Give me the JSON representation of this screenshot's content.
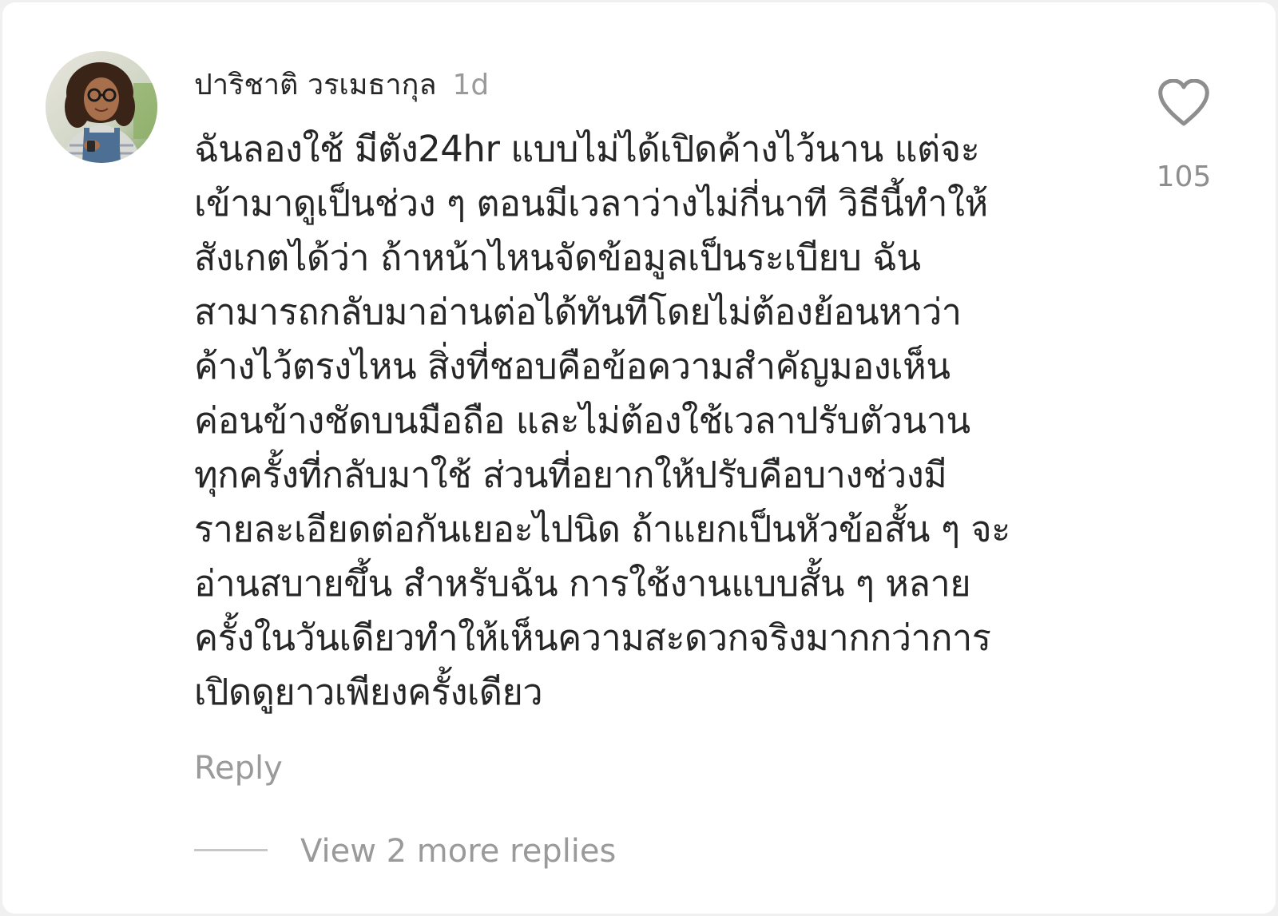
{
  "comment": {
    "username": "ปาริชาติ วรเมธากุล",
    "timestamp": "1d",
    "text": "ฉันลองใช้ มีตัง24hr แบบไม่ได้เปิดค้างไว้นาน แต่จะ\nเข้ามาดูเป็นช่วง ๆ ตอนมีเวลาว่างไม่กี่นาที วิธีนี้ทำให้\nสังเกตได้ว่า ถ้าหน้าไหนจัดข้อมูลเป็นระเบียบ ฉัน\nสามารถกลับมาอ่านต่อได้ทันทีโดยไม่ต้องย้อนหาว่า\nค้างไว้ตรงไหน สิ่งที่ชอบคือข้อความสำคัญมองเห็น\nค่อนข้างชัดบนมือถือ และไม่ต้องใช้เวลาปรับตัวนาน\nทุกครั้งที่กลับมาใช้ ส่วนที่อยากให้ปรับคือบางช่วงมี\nรายละเอียดต่อกันเยอะไปนิด ถ้าแยกเป็นหัวข้อสั้น ๆ จะ\nอ่านสบายขึ้น สำหรับฉัน การใช้งานแบบสั้น ๆ หลาย\nครั้งในวันเดียวทำให้เห็นความสะดวกจริงมากกว่าการ\nเปิดดูยาวเพียงครั้งเดียว",
    "like_count": "105",
    "like_icon": "heart-outline-icon",
    "reply_label": "Reply",
    "view_replies_label": "View 2 more replies"
  },
  "colors": {
    "background": "#ffffff",
    "text_primary": "#262626",
    "text_secondary": "#9a9a9a"
  }
}
